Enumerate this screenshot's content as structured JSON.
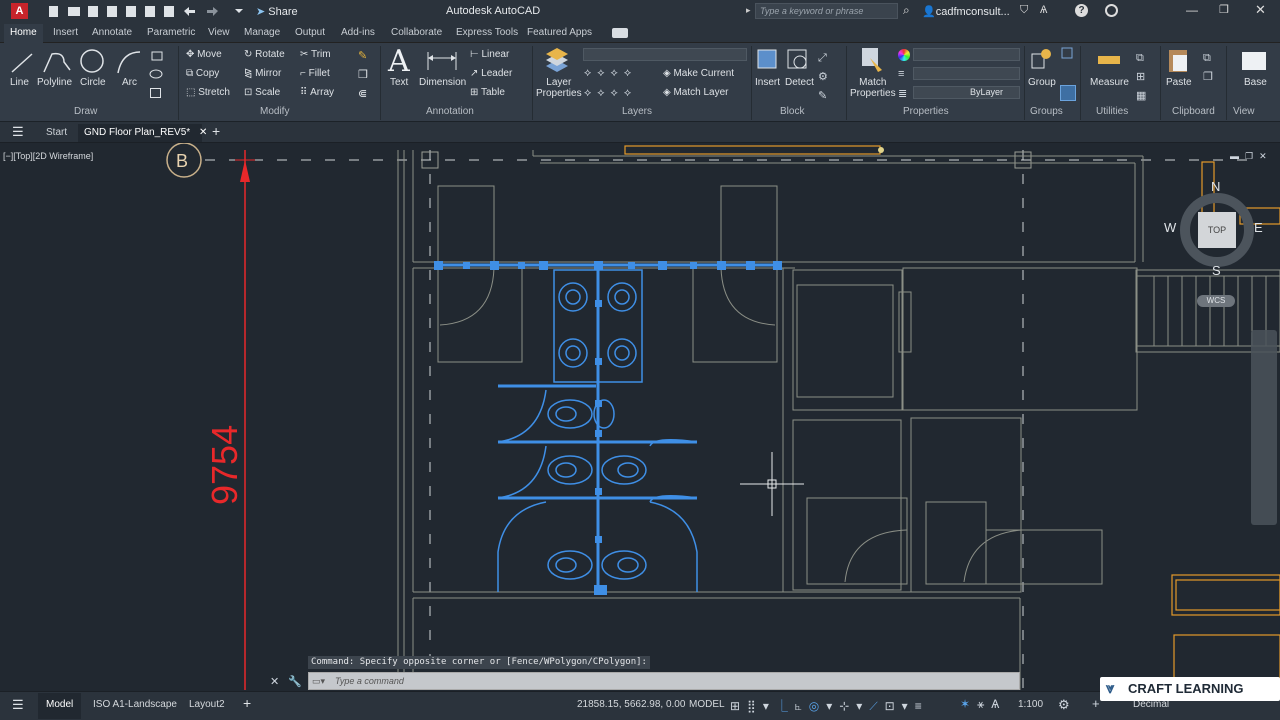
{
  "titlebar": {
    "app_icon": "A",
    "share_label": "Share",
    "title": "Autodesk AutoCAD",
    "search_placeholder": "Type a keyword or phrase",
    "user": "cadfmconsult..."
  },
  "ribbon_tabs": [
    "Home",
    "Insert",
    "Annotate",
    "Parametric",
    "View",
    "Manage",
    "Output",
    "Add-ins",
    "Collaborate",
    "Express Tools",
    "Featured Apps"
  ],
  "ribbon": {
    "draw": {
      "line": "Line",
      "polyline": "Polyline",
      "circle": "Circle",
      "arc": "Arc",
      "group": "Draw"
    },
    "modify": {
      "move": "Move",
      "rotate": "Rotate",
      "trim": "Trim",
      "copy": "Copy",
      "mirror": "Mirror",
      "fillet": "Fillet",
      "stretch": "Stretch",
      "scale": "Scale",
      "array": "Array",
      "group": "Modify"
    },
    "annotation": {
      "text": "Text",
      "dimension": "Dimension",
      "linear": "Linear",
      "leader": "Leader",
      "table": "Table",
      "group": "Annotation"
    },
    "layers": {
      "layer_properties_1": "Layer",
      "layer_properties_2": "Properties",
      "make_current": "Make Current",
      "match_layer": "Match Layer",
      "group": "Layers"
    },
    "block": {
      "insert": "Insert",
      "detect": "Detect",
      "group": "Block"
    },
    "properties": {
      "match_1": "Match",
      "match_2": "Properties",
      "bylayer": "ByLayer",
      "group": "Properties"
    },
    "groups": {
      "group_btn": "Group",
      "group": "Groups"
    },
    "utilities": {
      "measure": "Measure",
      "group": "Utilities"
    },
    "clipboard": {
      "paste": "Paste",
      "group": "Clipboard"
    },
    "view": {
      "base": "Base",
      "group": "View"
    }
  },
  "doctabs": {
    "start": "Start",
    "current": "GND Floor Plan_REV5*"
  },
  "viewport": {
    "label": "[−][Top][2D Wireframe]",
    "grid_bubble": "B",
    "dimension_text": "9754",
    "viewcube": {
      "n": "N",
      "s": "S",
      "e": "E",
      "w": "W",
      "face": "TOP",
      "ucs": "WCS"
    }
  },
  "command": {
    "history": "Command: Specify opposite corner or [Fence/WPolygon/CPolygon]:",
    "placeholder": "Type a command"
  },
  "statusbar": {
    "model_tab": "Model",
    "layout1": "ISO A1-Landscape",
    "layout2": "Layout2",
    "coords": "21858.15, 5662.98, 0.00",
    "mode": "MODEL",
    "scale": "1:100",
    "units": "Decimal"
  },
  "watermark": "CRAFT LEARNING",
  "colors": {
    "selection": "#3f8fe6",
    "dim_red": "#e8282a",
    "wall": "#8b8f86",
    "accent_orange": "#e39a2a"
  }
}
